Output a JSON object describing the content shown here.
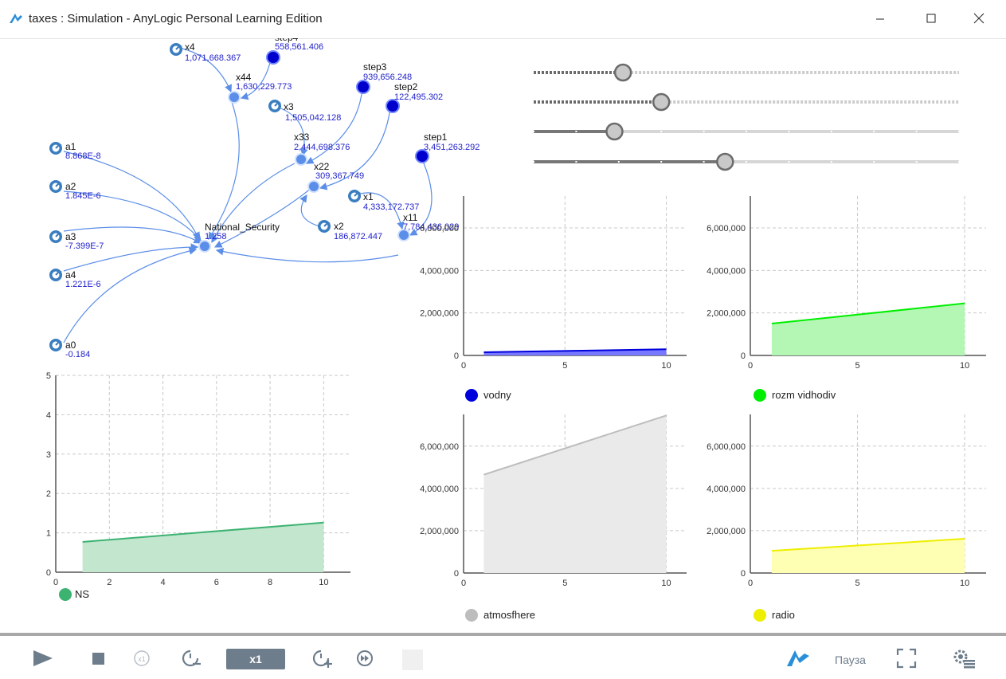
{
  "window": {
    "title": "taxes : Simulation - AnyLogic Personal Learning Edition",
    "minimize_glyph": "—",
    "maximize_glyph": "☐",
    "close_glyph": "✕"
  },
  "model": {
    "variables": [
      {
        "name": "x4",
        "value": "1,071,668.367"
      },
      {
        "name": "step4",
        "value": "558,561.406"
      },
      {
        "name": "x44",
        "value": "1,630,229.773"
      },
      {
        "name": "x3",
        "value": "1,505,042.128"
      },
      {
        "name": "step3",
        "value": "939,656.248"
      },
      {
        "name": "step2",
        "value": "122,495.302"
      },
      {
        "name": "x33",
        "value": "2,444,698.376"
      },
      {
        "name": "step1",
        "value": "3,451,263.292"
      },
      {
        "name": "x22",
        "value": "309,367.749"
      },
      {
        "name": "x1",
        "value": "4,333,172.737"
      },
      {
        "name": "x11",
        "value": "7,784,436.029"
      },
      {
        "name": "x2",
        "value": "186,872.447"
      },
      {
        "name": "National_Security",
        "value": "1.258"
      },
      {
        "name": "a1",
        "value": "8.868E-8"
      },
      {
        "name": "a2",
        "value": "1.845E-6"
      },
      {
        "name": "a3",
        "value": "-7.399E-7"
      },
      {
        "name": "a4",
        "value": "1.221E-6"
      },
      {
        "name": "a0",
        "value": "-0.184"
      }
    ]
  },
  "sliders": [
    {
      "name": "slider-1",
      "position": 0.21,
      "style": "dotted"
    },
    {
      "name": "slider-2",
      "position": 0.3,
      "style": "dotted"
    },
    {
      "name": "slider-3",
      "position": 0.19,
      "style": "ticks"
    },
    {
      "name": "slider-4",
      "position": 0.45,
      "style": "ticks"
    }
  ],
  "chart_data": [
    {
      "type": "area",
      "name": "NS",
      "x": [
        1,
        10
      ],
      "values": [
        0.77,
        1.26
      ],
      "xlim": [
        0,
        11
      ],
      "ylim": [
        0,
        5
      ],
      "xticks": [
        "0",
        "2",
        "4",
        "6",
        "8",
        "10"
      ],
      "yticks": [
        "0",
        "1",
        "2",
        "3",
        "4",
        "5"
      ],
      "color": "#3cb371",
      "fill": "#c3e6cf",
      "legend": "NS"
    },
    {
      "type": "area",
      "name": "vodny",
      "x": [
        1,
        10
      ],
      "values": [
        150000,
        290000
      ],
      "xlim": [
        0,
        11
      ],
      "ylim": [
        0,
        7500000
      ],
      "xticks": [
        "0",
        "5",
        "10"
      ],
      "yticks": [
        "0",
        "2,000,000",
        "4,000,000",
        "6,000,000"
      ],
      "color": "#0000dd",
      "fill": "#7777ff",
      "legend": "vodny"
    },
    {
      "type": "area",
      "name": "rozm vidhodiv",
      "x": [
        1,
        10
      ],
      "values": [
        1500000,
        2450000
      ],
      "xlim": [
        0,
        11
      ],
      "ylim": [
        0,
        7500000
      ],
      "xticks": [
        "0",
        "5",
        "10"
      ],
      "yticks": [
        "0",
        "2,000,000",
        "4,000,000",
        "6,000,000"
      ],
      "color": "#00ee00",
      "fill": "#b4f7b4",
      "legend": "rozm vidhodiv"
    },
    {
      "type": "area",
      "name": "atmosfhere",
      "x": [
        1,
        10
      ],
      "values": [
        4650000,
        7450000
      ],
      "xlim": [
        0,
        11
      ],
      "ylim": [
        0,
        7500000
      ],
      "xticks": [
        "0",
        "5",
        "10"
      ],
      "yticks": [
        "0",
        "2,000,000",
        "4,000,000",
        "6,000,000"
      ],
      "color": "#bdbdbd",
      "fill": "#eaeaea",
      "legend": "atmosfhere"
    },
    {
      "type": "area",
      "name": "radio",
      "x": [
        1,
        10
      ],
      "values": [
        1050000,
        1620000
      ],
      "xlim": [
        0,
        11
      ],
      "ylim": [
        0,
        7500000
      ],
      "xticks": [
        "0",
        "5",
        "10"
      ],
      "yticks": [
        "0",
        "2,000,000",
        "4,000,000",
        "6,000,000"
      ],
      "color": "#eeee00",
      "fill": "#ffffb3",
      "legend": "radio"
    }
  ],
  "toolbar": {
    "speed_label": "x1",
    "pause_label": "Пауза",
    "icons": [
      "play-icon",
      "stop-icon",
      "x1-icon",
      "slower-icon",
      "faster-icon",
      "run-fast-icon",
      "anylogic-logo-icon",
      "fullscreen-icon",
      "settings-icon"
    ]
  }
}
